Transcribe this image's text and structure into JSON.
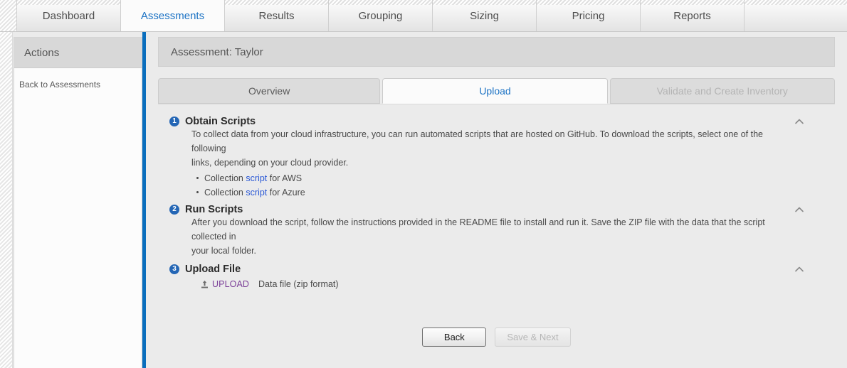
{
  "topnav": {
    "tabs": [
      {
        "label": "Dashboard",
        "active": false
      },
      {
        "label": "Assessments",
        "active": true
      },
      {
        "label": "Results",
        "active": false
      },
      {
        "label": "Grouping",
        "active": false
      },
      {
        "label": "Sizing",
        "active": false
      },
      {
        "label": "Pricing",
        "active": false
      },
      {
        "label": "Reports",
        "active": false
      }
    ]
  },
  "sidebar": {
    "header": "Actions",
    "links": [
      {
        "label": "Back to Assessments"
      }
    ]
  },
  "main": {
    "assessment_header": "Assessment: Taylor",
    "subtabs": [
      {
        "label": "Overview",
        "state": "inactive"
      },
      {
        "label": "Upload",
        "state": "active"
      },
      {
        "label": "Validate and Create Inventory",
        "state": "disabled"
      }
    ],
    "sections": [
      {
        "number": "1",
        "title": "Obtain Scripts",
        "paragraph_a": "To collect data from your cloud infrastructure, you can run automated scripts that are hosted on GitHub. To download the scripts, select one of the following",
        "paragraph_b": "links, depending on your cloud provider.",
        "bullets": [
          {
            "before": "Collection ",
            "link": "script",
            "after": " for AWS"
          },
          {
            "before": "Collection ",
            "link": "script",
            "after": " for Azure"
          }
        ],
        "collapse_icon": "chevron-up-icon"
      },
      {
        "number": "2",
        "title": "Run Scripts",
        "paragraph_a": "After you download the script, follow the instructions provided in the README file to install and run it. Save the ZIP file with the data that the script collected in",
        "paragraph_b": "your local folder.",
        "collapse_icon": "chevron-up-icon"
      },
      {
        "number": "3",
        "title": "Upload File",
        "upload_icon": "upload-icon",
        "upload_label": "UPLOAD",
        "upload_note": "Data file (zip format)",
        "collapse_icon": "chevron-up-icon"
      }
    ],
    "footer": {
      "back_label": "Back",
      "save_next_label": "Save & Next",
      "save_next_disabled": true
    }
  },
  "colors": {
    "accent_blue": "#0a6ebd",
    "tab_link_blue": "#1b72c4",
    "badge_blue": "#2466b5",
    "link_blue": "#2b59d6",
    "visited_purple": "#7b3f98",
    "body_bg": "#ebebeb",
    "header_gray": "#d8d8d8"
  }
}
